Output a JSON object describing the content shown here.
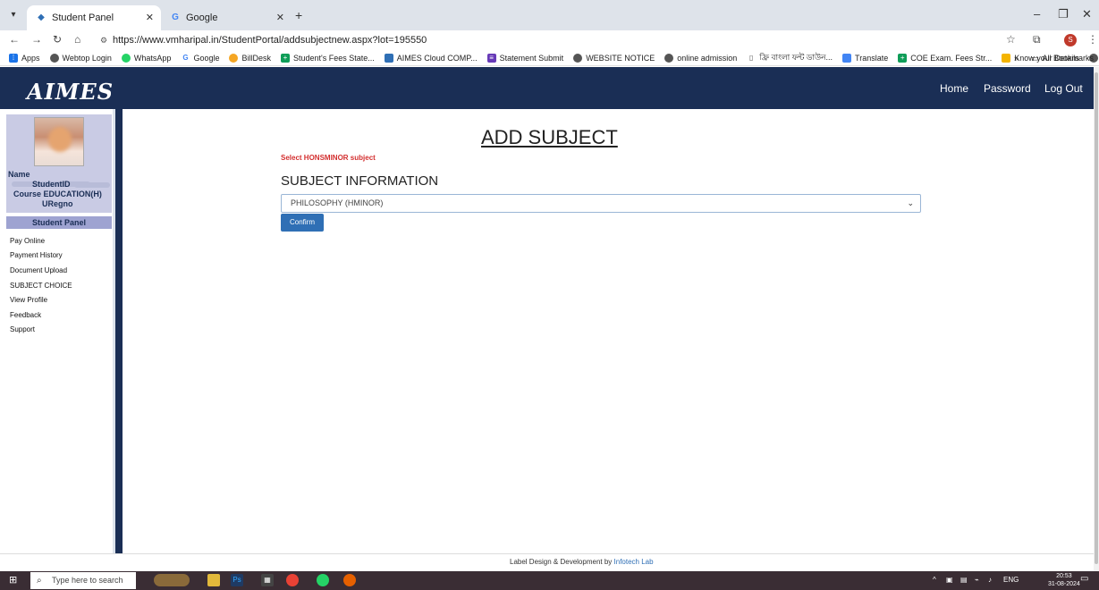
{
  "browser": {
    "tabs": [
      {
        "title": "Student Panel",
        "active": true
      },
      {
        "title": "Google",
        "active": false
      }
    ],
    "url": "https://www.vmharipal.in/StudentPortal/addsubjectnew.aspx?lot=195550",
    "bookmarks": [
      "Apps",
      "Webtop Login",
      "WhatsApp",
      "Google",
      "BillDesk",
      "Student's Fees State...",
      "AIMES Cloud COMP...",
      "Statement Submit",
      "WEBSITE NOTICE",
      "online admission",
      "ফ্রি বাংলা ফন্ট ডাউন...",
      "Translate",
      "COE Exam. Fees Str...",
      "Know your Details"
    ],
    "all_bookmarks": "All Bookmarks",
    "profile_initial": "S"
  },
  "site": {
    "logo": "AIMES",
    "nav": [
      "Home",
      "Password",
      "Log Out"
    ]
  },
  "sidebar": {
    "name_label": "Name",
    "studentid_label": "StudentID",
    "course_label": "Course",
    "course_value": "EDUCATION(H)",
    "uregno_label": "URegno",
    "panel_title": "Student Panel",
    "menu": [
      "Pay Online",
      "Payment History",
      "Document Upload",
      "SUBJECT CHOICE",
      "View Profile",
      "Feedback",
      "Support"
    ]
  },
  "main": {
    "title": "ADD SUBJECT",
    "select_note": "Select HONSMINOR subject",
    "section_heading": "SUBJECT INFORMATION",
    "selected_subject": "PHILOSOPHY (HMINOR)",
    "confirm_label": "Confirm"
  },
  "footer": {
    "text": "Label  Design & Development by ",
    "link": "Infotech Lab"
  },
  "taskbar": {
    "search_placeholder": "Type here to search",
    "lang": "ENG",
    "time": "20:53",
    "date": "31-08-2024"
  }
}
